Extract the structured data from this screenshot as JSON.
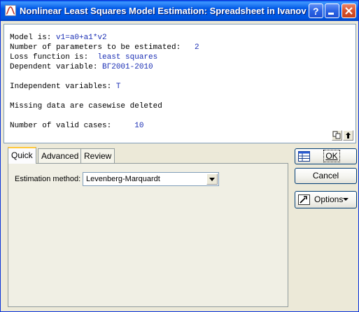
{
  "window": {
    "title": "Nonlinear Least Squares Model Estimation: Spreadsheet in Ivanov",
    "title_buttons": [
      "help-icon",
      "minimize-icon",
      "close-icon"
    ]
  },
  "output": {
    "lines": [
      {
        "label": "Model is: ",
        "value": "v1=a0+a1*v2"
      },
      {
        "label": "Number of parameters to be estimated:   ",
        "value": "2"
      },
      {
        "label": "Loss function is:  ",
        "value": "least squares"
      },
      {
        "label": "Dependent variable: ",
        "value": "ВГ2001-2010"
      },
      {
        "label": "",
        "value": ""
      },
      {
        "label": "Independent variables: ",
        "value": "T"
      },
      {
        "label": "",
        "value": ""
      },
      {
        "label": "Missing data are casewise deleted",
        "value": ""
      },
      {
        "label": "",
        "value": ""
      },
      {
        "label": "Number of valid cases:     ",
        "value": "10"
      }
    ]
  },
  "tabs": [
    {
      "label": "Quick",
      "active": true
    },
    {
      "label": "Advanced",
      "active": false
    },
    {
      "label": "Review",
      "active": false
    }
  ],
  "quick": {
    "estimation_label": "Estimation method:",
    "estimation_value": "Levenberg-Marquardt"
  },
  "buttons": {
    "ok": "OK",
    "cancel": "Cancel",
    "options": "Options"
  },
  "colors": {
    "value_text": "#1a2eb4",
    "titlebar": "#0055DF",
    "face": "#ECE9D8"
  }
}
